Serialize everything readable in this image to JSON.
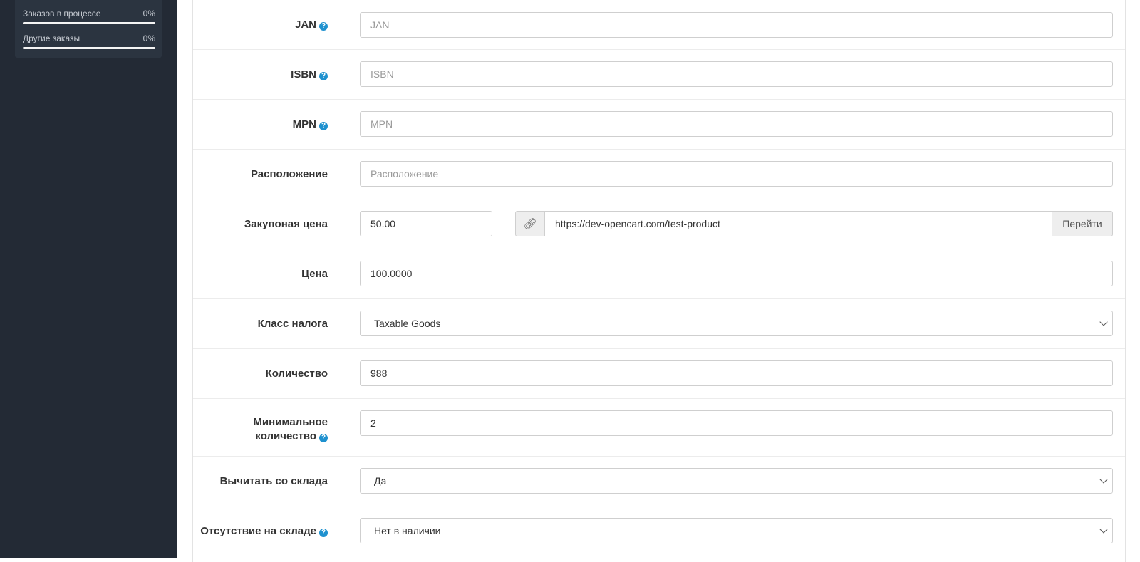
{
  "sidebar": {
    "stats": [
      {
        "label": "Заказов в процессе",
        "value": "0%",
        "progress": 0
      },
      {
        "label": "Другие заказы",
        "value": "0%",
        "progress": 0
      }
    ]
  },
  "form": {
    "jan": {
      "label": "JAN",
      "placeholder": "JAN",
      "value": ""
    },
    "isbn": {
      "label": "ISBN",
      "placeholder": "ISBN",
      "value": ""
    },
    "mpn": {
      "label": "MPN",
      "placeholder": "MPN",
      "value": ""
    },
    "location": {
      "label": "Расположение",
      "placeholder": "Расположение",
      "value": ""
    },
    "purchase_price": {
      "label": "Закупоная цена",
      "value": "50.00",
      "link_value": "https://dev-opencart.com/test-product",
      "go_button": "Перейти"
    },
    "price": {
      "label": "Цена",
      "value": "100.0000"
    },
    "tax_class": {
      "label": "Класс налога",
      "selected": "Taxable Goods"
    },
    "quantity": {
      "label": "Количество",
      "value": "988"
    },
    "minimum": {
      "label_line1": "Минимальное",
      "label_line2": "количество",
      "value": "2"
    },
    "subtract": {
      "label": "Вычитать со склада",
      "selected": "Да"
    },
    "stock_status": {
      "label": "Отсутствие на складе",
      "selected": "Нет в наличии"
    }
  },
  "icons": {
    "help": "question-circle-icon",
    "link": "link-icon",
    "chevron": "chevron-down-icon"
  },
  "colors": {
    "sidebar_bg": "#232a35",
    "accent": "#1e91cf"
  }
}
